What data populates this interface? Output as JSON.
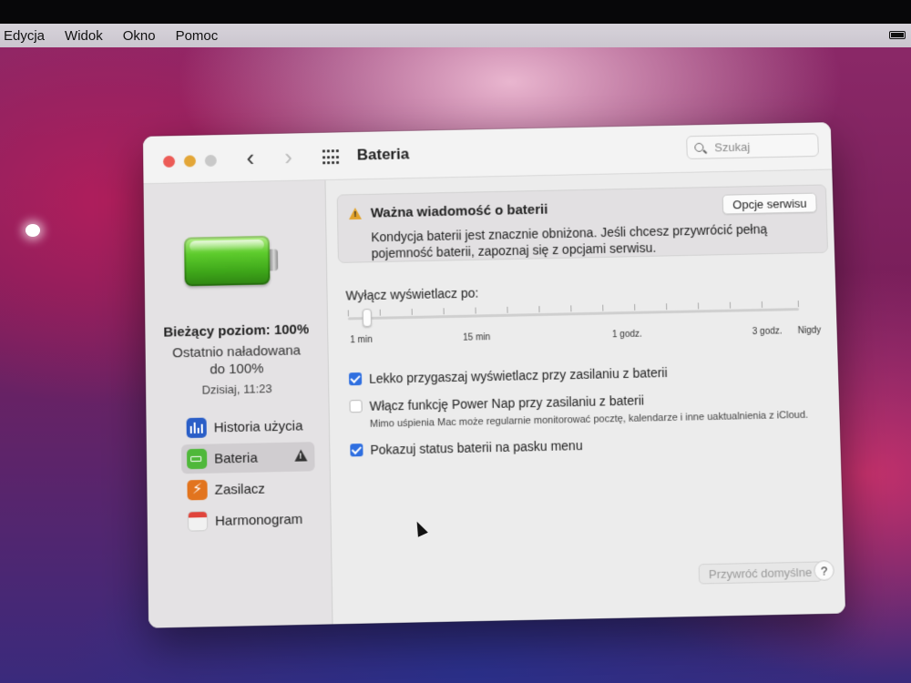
{
  "menubar": {
    "items": [
      "Edycja",
      "Widok",
      "Okno",
      "Pomoc"
    ]
  },
  "window": {
    "title": "Bateria",
    "search_placeholder": "Szukaj"
  },
  "sidebar": {
    "level_title": "Bieżący poziom: 100%",
    "level_sub_1": "Ostatnio naładowana",
    "level_sub_2": "do 100%",
    "level_time": "Dzisiaj, 11:23",
    "items": [
      {
        "label": "Historia użycia",
        "icon": "bar-chart-icon"
      },
      {
        "label": "Bateria",
        "icon": "battery-icon",
        "active": true,
        "warning": true
      },
      {
        "label": "Zasilacz",
        "icon": "lightning-icon"
      },
      {
        "label": "Harmonogram",
        "icon": "calendar-icon"
      }
    ]
  },
  "alert": {
    "title": "Ważna wiadomość o baterii",
    "body": "Kondycja baterii jest znacznie obniżona. Jeśli chcesz przywrócić pełną pojemność baterii, zapoznaj się z opcjami serwisu.",
    "button": "Opcje serwisu"
  },
  "display_off": {
    "label": "Wyłącz wyświetlacz po:",
    "tick_labels": [
      "1 min",
      "15 min",
      "1 godz.",
      "3 godz.",
      "Nigdy"
    ],
    "selected": "1 min"
  },
  "options": [
    {
      "label": "Lekko przygaszaj wyświetlacz przy zasilaniu z baterii",
      "checked": true
    },
    {
      "label": "Włącz funkcję Power Nap przy zasilaniu z baterii",
      "checked": false,
      "note": "Mimo uśpienia Mac może regularnie monitorować pocztę, kalendarze i inne uaktualnienia z iCloud."
    },
    {
      "label": "Pokazuj status baterii na pasku menu",
      "checked": true
    }
  ],
  "footer": {
    "restore": "Przywróć domyślne",
    "help": "?"
  },
  "colors": {
    "accent": "#2f6fe0",
    "battery_green": "#4fb83a",
    "warning": "#e2a22a"
  }
}
